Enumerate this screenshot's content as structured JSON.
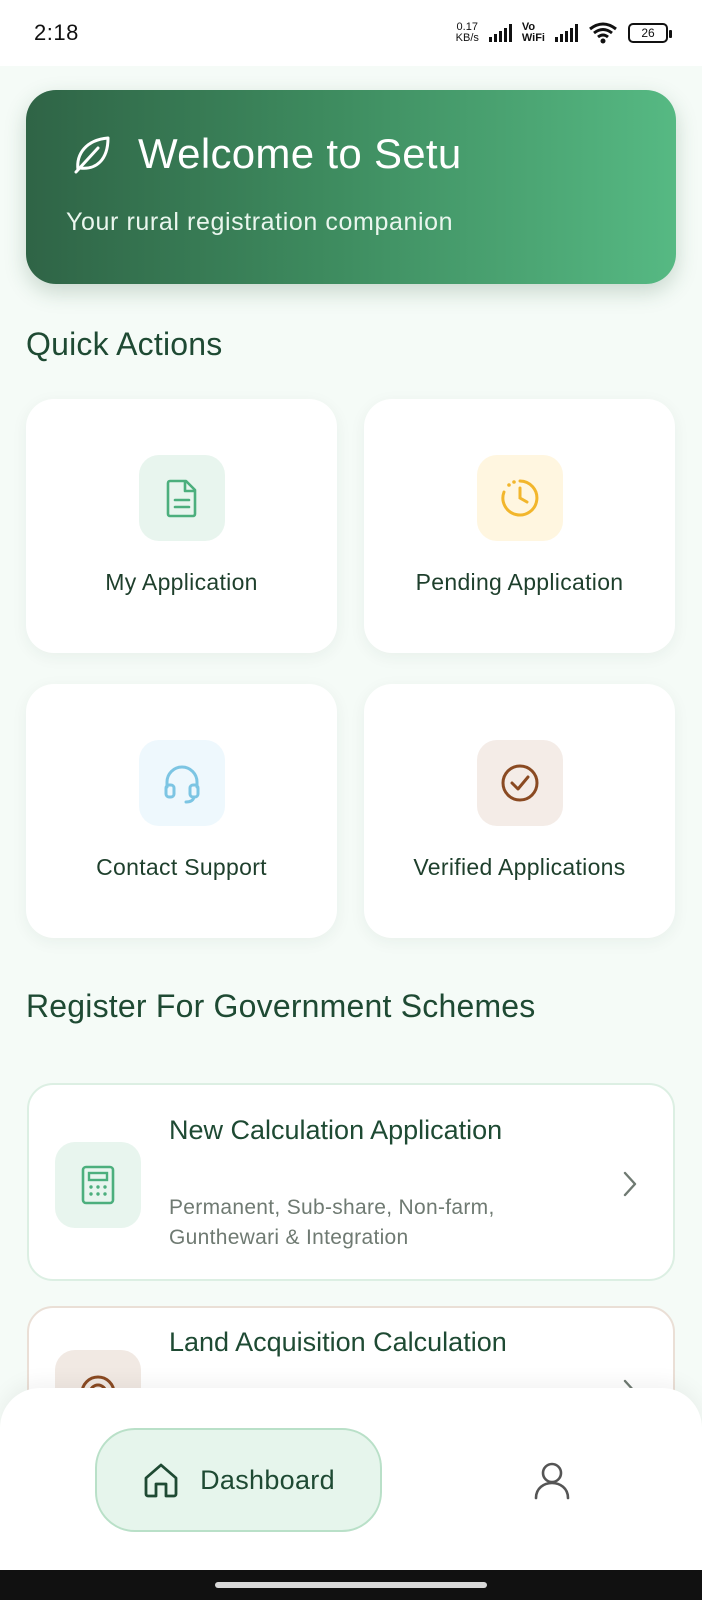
{
  "status_bar": {
    "time": "2:18",
    "net_speed_value": "0.17",
    "net_speed_unit": "KB/s",
    "vowifi_top": "Vo",
    "vowifi_bottom": "WiFi",
    "battery": "26"
  },
  "banner": {
    "icon": "leaf-icon",
    "title": "Welcome to Setu",
    "subtitle": "Your rural registration companion"
  },
  "quick_actions": {
    "title": "Quick Actions",
    "items": [
      {
        "label": "My Application",
        "icon": "document-icon",
        "icon_color": "#4caf7d",
        "tile_color": "#e8f5ee"
      },
      {
        "label": "Pending Application",
        "icon": "clock-icon",
        "icon_color": "#f2b62c",
        "tile_color": "#fff6e0"
      },
      {
        "label": "Contact Support",
        "icon": "headset-icon",
        "icon_color": "#7cc5e3",
        "tile_color": "#eef8fd"
      },
      {
        "label": "Verified Applications",
        "icon": "check-circle-icon",
        "icon_color": "#8a4a22",
        "tile_color": "#f4ece7"
      }
    ]
  },
  "schemes": {
    "title": "Register For Government Schemes",
    "items": [
      {
        "title": "New Calculation Application",
        "description": "Permanent, Sub-share, Non-farm, Gunthewari & Integration",
        "icon": "calculator-icon"
      },
      {
        "title": "Land Acquisition Calculation",
        "description": "",
        "icon": "target-icon"
      }
    ]
  },
  "bottom_nav": {
    "dashboard_label": "Dashboard",
    "profile_icon": "user-icon"
  },
  "colors": {
    "accent": "#2f6446",
    "accent_light": "#56b983",
    "background": "#f5fbf7"
  }
}
